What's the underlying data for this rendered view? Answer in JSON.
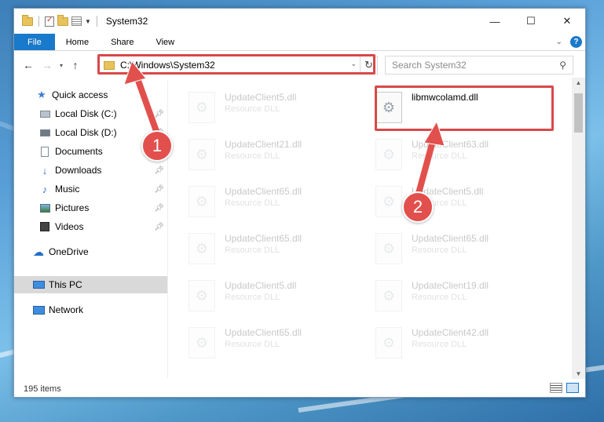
{
  "window": {
    "title": "System32",
    "controls": {
      "minimize": "—",
      "maximize": "☐",
      "close": "✕"
    }
  },
  "ribbon": {
    "tabs": [
      "File",
      "Home",
      "Share",
      "View"
    ],
    "help": "?"
  },
  "address": {
    "path": "C:\\Windows\\System32",
    "search_placeholder": "Search System32"
  },
  "nav": {
    "items": [
      {
        "label": "Quick access",
        "icon": "star-icon",
        "pinned": false
      },
      {
        "label": "Local Disk (C:)",
        "icon": "disk-icon",
        "pinned": true
      },
      {
        "label": "Local Disk (D:)",
        "icon": "disk-icon",
        "pinned": true
      },
      {
        "label": "Documents",
        "icon": "document-icon",
        "pinned": true
      },
      {
        "label": "Downloads",
        "icon": "download-icon",
        "pinned": true
      },
      {
        "label": "Music",
        "icon": "music-icon",
        "pinned": true
      },
      {
        "label": "Pictures",
        "icon": "pictures-icon",
        "pinned": true
      },
      {
        "label": "Videos",
        "icon": "videos-icon",
        "pinned": true
      },
      {
        "label": "OneDrive",
        "icon": "cloud-icon",
        "pinned": false
      },
      {
        "label": "This PC",
        "icon": "computer-icon",
        "pinned": false,
        "selected": true
      },
      {
        "label": "Network",
        "icon": "network-icon",
        "pinned": false
      }
    ]
  },
  "files": {
    "left_column": [
      {
        "name": "UpdateClient5.dll",
        "type": "Resource DLL"
      },
      {
        "name": "UpdateClient21.dll",
        "type": "Resource DLL"
      },
      {
        "name": "UpdateClient65.dll",
        "type": "Resource DLL"
      },
      {
        "name": "UpdateClient65.dll",
        "type": "Resource DLL"
      },
      {
        "name": "UpdateClient5.dll",
        "type": "Resource DLL"
      },
      {
        "name": "UpdateClient65.dll",
        "type": "Resource DLL"
      }
    ],
    "right_column": [
      {
        "name": "libmwcolamd.dll",
        "type": "",
        "highlighted": true
      },
      {
        "name": "UpdateClient63.dll",
        "type": "Resource DLL"
      },
      {
        "name": "UpdateClient5.dll",
        "type": "Resource DLL"
      },
      {
        "name": "UpdateClient65.dll",
        "type": "Resource DLL"
      },
      {
        "name": "UpdateClient19.dll",
        "type": "Resource DLL"
      },
      {
        "name": "UpdateClient42.dll",
        "type": "Resource DLL"
      }
    ]
  },
  "status": {
    "item_count": "195 items"
  },
  "annotations": {
    "step1": "1",
    "step2": "2",
    "color": "#e2504d"
  }
}
